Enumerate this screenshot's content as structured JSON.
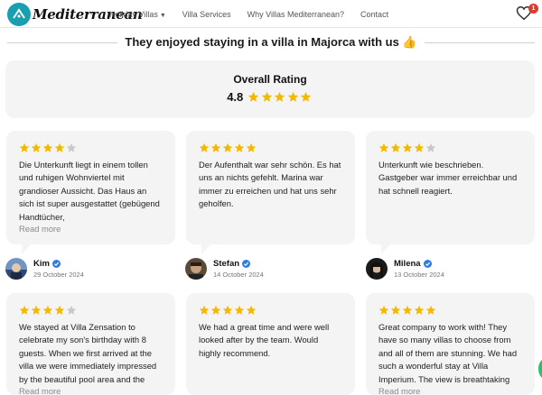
{
  "header": {
    "logo_text": "Mediterranean",
    "nav": [
      {
        "label": "Holiday Villas",
        "has_caret": true
      },
      {
        "label": "Villa Services"
      },
      {
        "label": "Why Villas Mediterranean?"
      },
      {
        "label": "Contact"
      }
    ],
    "cart_count": "1"
  },
  "section_title": "They enjoyed staying in a villa in Majorca with us 👍",
  "overall": {
    "label": "Overall Rating",
    "score": "4.8",
    "stars": 5
  },
  "read_more_label": "Read more",
  "reviews": [
    {
      "stars": 4,
      "text": "Die Unterkunft liegt in einem tollen und ruhigen Wohnviertel mit grandioser Aussicht. Das Haus an sich ist super ausgestattet (gebügend Handtücher,",
      "read_more": true,
      "author": "Kim",
      "date": "29 October 2024"
    },
    {
      "stars": 5,
      "text": "Der Aufenthalt war sehr schön. Es hat uns an nichts gefehlt. Marina war immer zu erreichen und hat uns sehr geholfen.",
      "read_more": false,
      "author": "Stefan",
      "date": "14 October 2024"
    },
    {
      "stars": 4,
      "text": "Unterkunft wie beschrieben. Gastgeber war immer erreichbar und hat schnell reagiert.",
      "read_more": false,
      "author": "Milena",
      "date": "13 October 2024"
    },
    {
      "stars": 4,
      "text": "We stayed at Villa Zensation to celebrate my son's birthday with 8 guests. When we first arrived at the villa we were immediately impressed by the beautiful pool area and the",
      "read_more": true
    },
    {
      "stars": 5,
      "text": "We had a great time and were well looked after by the team. Would highly recommend.",
      "read_more": false
    },
    {
      "stars": 5,
      "text": "Great company to work with! They have so many villas to choose from and all of them are stunning. We had such a wonderful stay at Villa Imperium. The view is breathtaking",
      "read_more": true
    }
  ],
  "colors": {
    "star_filled": "#f5b800",
    "star_empty": "#c8c8c8",
    "card_bg": "#f4f4f4",
    "verified": "#2f7de1",
    "logo": "#1a9fb0",
    "badge": "#e03a2e"
  },
  "icons": {
    "cart": "heart-icon",
    "verified": "verified-check-icon",
    "star": "star-icon"
  }
}
